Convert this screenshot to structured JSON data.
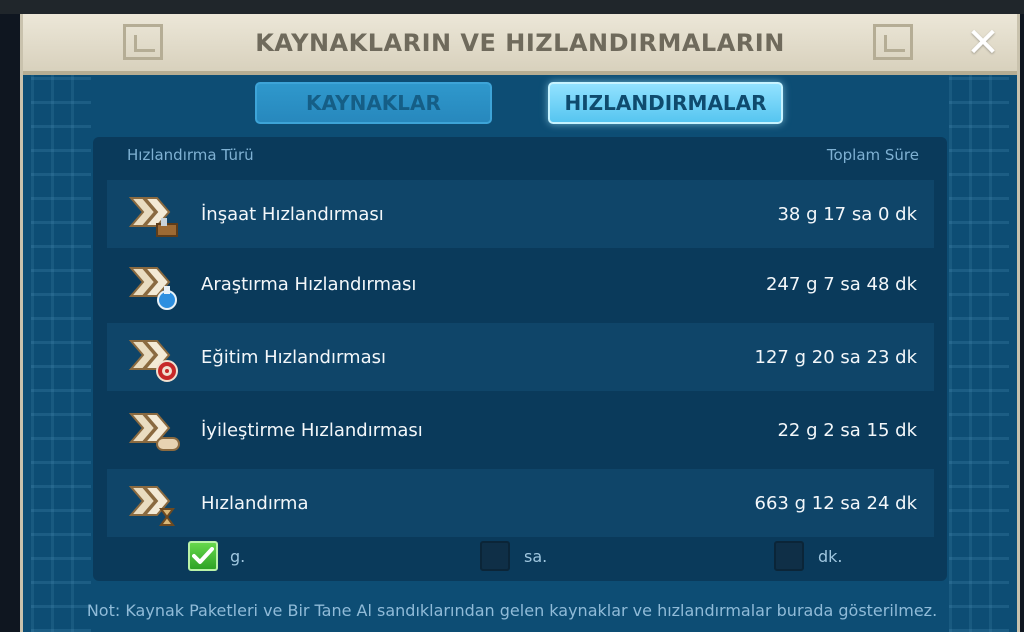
{
  "window": {
    "title": "KAYNAKLARIN VE HIZLANDIRMALARIN",
    "close_icon": "close-icon"
  },
  "tabs": [
    {
      "label": "KAYNAKLAR",
      "active": false
    },
    {
      "label": "HIZLANDIRMALAR",
      "active": true
    }
  ],
  "table": {
    "headers": {
      "type": "Hızlandırma Türü",
      "total": "Toplam Süre"
    },
    "rows": [
      {
        "label": "İnşaat Hızlandırması",
        "value": "38 g 17 sa 0 dk",
        "icon": "construction-speedup-icon"
      },
      {
        "label": "Araştırma Hızlandırması",
        "value": "247 g 7 sa 48 dk",
        "icon": "research-speedup-icon"
      },
      {
        "label": "Eğitim Hızlandırması",
        "value": "127 g 20 sa 23 dk",
        "icon": "training-speedup-icon"
      },
      {
        "label": "İyileştirme Hızlandırması",
        "value": "22 g 2 sa 15 dk",
        "icon": "healing-speedup-icon"
      },
      {
        "label": "Hızlandırma",
        "value": "663 g 12 sa 24 dk",
        "icon": "universal-speedup-icon"
      }
    ]
  },
  "units": [
    {
      "label": "g.",
      "checked": true
    },
    {
      "label": "sa.",
      "checked": false
    },
    {
      "label": "dk.",
      "checked": false
    }
  ],
  "footnote": "Not: Kaynak Paketleri ve Bir Tane Al sandıklarından gelen kaynaklar ve hızlandırmalar burada gösterilmez.",
  "colors": {
    "accent": "#56c5f0",
    "panel": "#0a3a5b",
    "check_on": "#2fa326"
  }
}
